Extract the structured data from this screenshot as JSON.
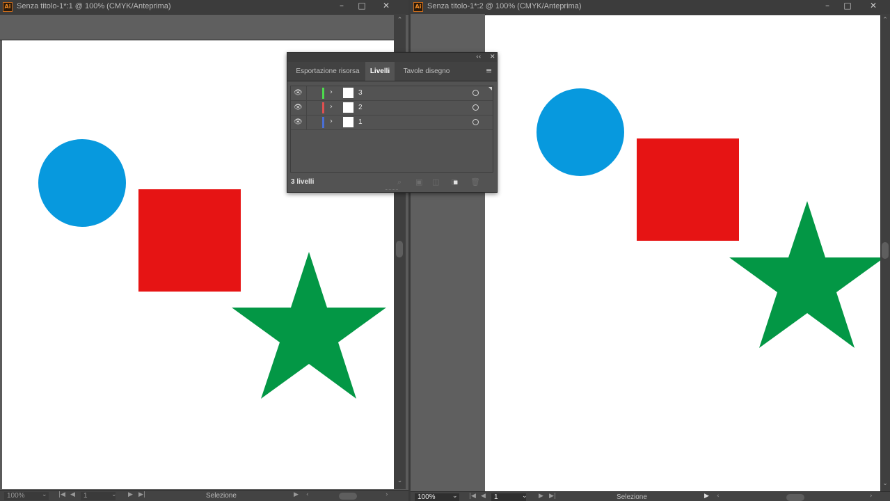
{
  "windows": [
    {
      "title": "Senza titolo-1*:1 @ 100% (CMYK/Anteprima)",
      "status": {
        "zoom": "100%",
        "page": "1",
        "tool": "Selezione"
      }
    },
    {
      "title": "Senza titolo-1*:2 @ 100% (CMYK/Anteprima)",
      "status": {
        "zoom": "100%",
        "page": "1",
        "tool": "Selezione"
      }
    }
  ],
  "window_controls": {
    "minimize": "–",
    "restore": "□",
    "close": "✕"
  },
  "app_icon": "Ai",
  "shapes": {
    "circle_color": "#0799de",
    "square_color": "#e61414",
    "star_color": "#039745"
  },
  "panel": {
    "tabs": [
      "Esportazione risorsa",
      "Livelli",
      "Tavole disegno"
    ],
    "active_tab": "Livelli",
    "layers": [
      {
        "name": "3",
        "color": "#4ddb4d"
      },
      {
        "name": "2",
        "color": "#e05050"
      },
      {
        "name": "1",
        "color": "#4a6fd6"
      }
    ],
    "footer": {
      "count_label": "3 livelli",
      "icons": [
        "search-icon",
        "collect-export-icon",
        "make-clipping-mask-icon",
        "new-sublayer-icon",
        "new-layer-icon",
        "delete-icon"
      ]
    }
  }
}
